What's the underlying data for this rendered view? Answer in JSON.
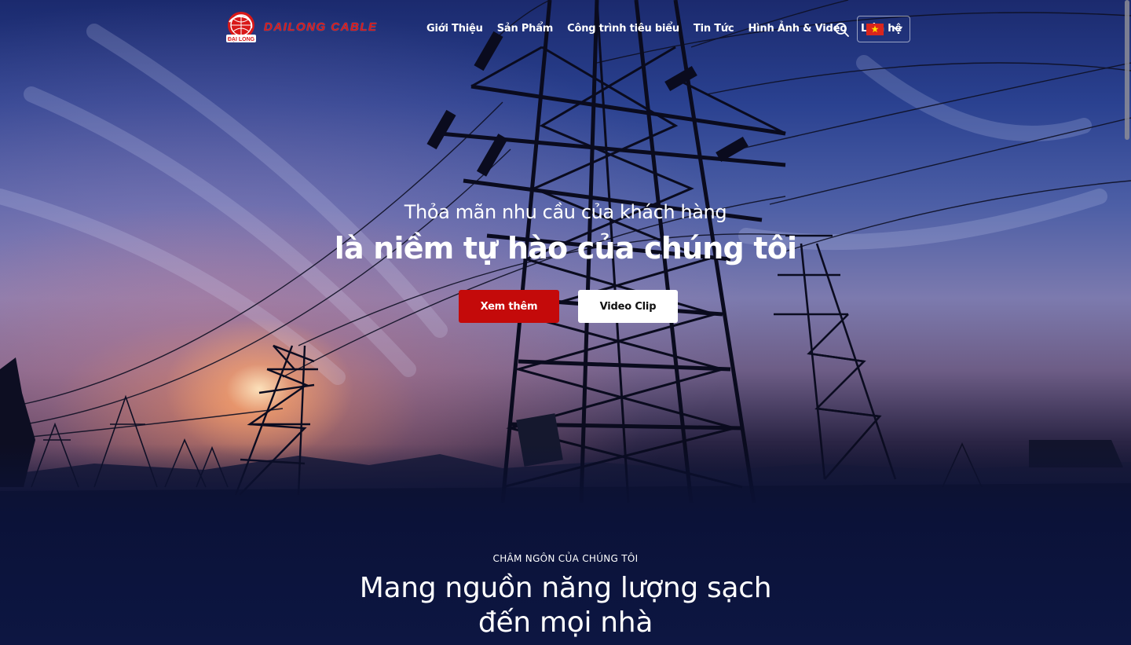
{
  "header": {
    "logo": {
      "text": "DAILONG CABLE",
      "mark_text": "ĐẠI LONG"
    },
    "nav": [
      {
        "label": "Giới Thiệu"
      },
      {
        "label": "Sản Phẩm"
      },
      {
        "label": "Công trình tiêu biểu"
      },
      {
        "label": "Tin Tức"
      },
      {
        "label": "Hình Ảnh & Video"
      },
      {
        "label": "Liên hệ"
      }
    ],
    "search_icon": "search-icon",
    "language": {
      "flag": "vietnam-flag-icon",
      "selected": "vi"
    }
  },
  "hero": {
    "subtitle": "Thỏa mãn nhu cầu của khách hàng",
    "title": "là niềm tự hào của chúng tôi",
    "primary_button": "Xem thêm",
    "secondary_button": "Video Clip"
  },
  "motto": {
    "eyebrow": "CHÂM NGÔN CỦA CHÚNG TÔI",
    "title_line1": "Mang nguồn năng lượng sạch",
    "title_line2": "đến mọi nhà"
  },
  "colors": {
    "brand_red": "#c40a0a",
    "logo_red": "#d81818",
    "navy": "#0b1238",
    "white": "#ffffff"
  }
}
